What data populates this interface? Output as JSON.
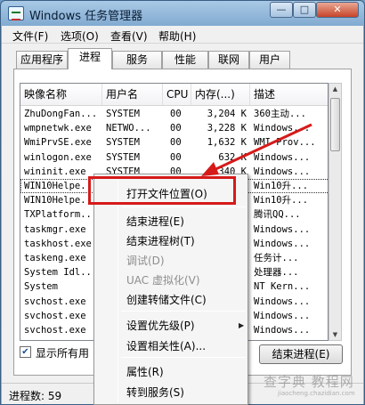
{
  "window": {
    "title": "Windows 任务管理器",
    "controls": {
      "minimize": "—",
      "maximize": "□",
      "close": "✕"
    }
  },
  "menu": [
    "文件(F)",
    "选项(O)",
    "查看(V)",
    "帮助(H)"
  ],
  "tabs": [
    {
      "label": "应用程序",
      "active": false
    },
    {
      "label": "进程",
      "active": true
    },
    {
      "label": "服务",
      "active": false
    },
    {
      "label": "性能",
      "active": false
    },
    {
      "label": "联网",
      "active": false
    },
    {
      "label": "用户",
      "active": false
    }
  ],
  "columns": [
    "映像名称",
    "用户名",
    "CPU",
    "内存(...)",
    "描述"
  ],
  "rows": [
    {
      "name": "ZhuDongFan...",
      "user": "SYSTEM",
      "cpu": "00",
      "mem": "3,204 K",
      "desc": "360主动..."
    },
    {
      "name": "wmpnetwk.exe",
      "user": "NETWO...",
      "cpu": "00",
      "mem": "3,228 K",
      "desc": "Windows..."
    },
    {
      "name": "WmiPrvSE.exe",
      "user": "SYSTEM",
      "cpu": "00",
      "mem": "1,632 K",
      "desc": "WMI Prov..."
    },
    {
      "name": "winlogon.exe",
      "user": "SYSTEM",
      "cpu": "00",
      "mem": "632 K",
      "desc": "Windows..."
    },
    {
      "name": "wininit.exe",
      "user": "SYSTEM",
      "cpu": "00",
      "mem": "340 K",
      "desc": "Windows..."
    },
    {
      "name": "WIN10Helpe...",
      "user": "",
      "cpu": "",
      "mem": "",
      "desc": "Win10升..."
    },
    {
      "name": "WIN10Helpe...",
      "user": "",
      "cpu": "",
      "mem": "",
      "desc": "Win10升..."
    },
    {
      "name": "TXPlatform...",
      "user": "",
      "cpu": "",
      "mem": "",
      "desc": "腾讯QQ..."
    },
    {
      "name": "taskmgr.exe",
      "user": "",
      "cpu": "",
      "mem": "",
      "desc": "Windows..."
    },
    {
      "name": "taskhost.exe",
      "user": "",
      "cpu": "",
      "mem": "",
      "desc": "Windows..."
    },
    {
      "name": "taskeng.exe",
      "user": "",
      "cpu": "",
      "mem": "",
      "desc": "任务计..."
    },
    {
      "name": "System Idl...",
      "user": "",
      "cpu": "",
      "mem": "",
      "desc": "处理器..."
    },
    {
      "name": "System",
      "user": "",
      "cpu": "",
      "mem": "",
      "desc": "NT Kern..."
    },
    {
      "name": "svchost.exe",
      "user": "",
      "cpu": "",
      "mem": "",
      "desc": "Windows..."
    },
    {
      "name": "svchost.exe",
      "user": "",
      "cpu": "",
      "mem": "",
      "desc": "Windows..."
    },
    {
      "name": "svchost.exe",
      "user": "",
      "cpu": "",
      "mem": "",
      "desc": "Windows..."
    }
  ],
  "show_all": {
    "label": "显示所有用",
    "checked": true
  },
  "end_process_button": "结束进程(E)",
  "status": "进程数: 59",
  "context_menu": {
    "items": [
      {
        "label": "打开文件位置(O)",
        "disabled": false,
        "submenu": false
      },
      {
        "label": "结束进程(E)",
        "disabled": false,
        "submenu": false
      },
      {
        "label": "结束进程树(T)",
        "disabled": false,
        "submenu": false
      },
      {
        "label": "调试(D)",
        "disabled": true,
        "submenu": false
      },
      {
        "label": "UAC 虚拟化(V)",
        "disabled": true,
        "submenu": false
      },
      {
        "label": "创建转储文件(C)",
        "disabled": false,
        "submenu": false
      },
      {
        "label": "设置优先级(P)",
        "disabled": false,
        "submenu": true
      },
      {
        "label": "设置相关性(A)...",
        "disabled": false,
        "submenu": false
      },
      {
        "label": "属性(R)",
        "disabled": false,
        "submenu": false
      },
      {
        "label": "转到服务(S)",
        "disabled": false,
        "submenu": false
      }
    ],
    "highlighted": "打开文件位置(O)"
  },
  "watermark": {
    "text": "查字典 教程网",
    "sub": "jiaocheng.chazidian.com"
  },
  "colors": {
    "highlight_box": "#d61a1a",
    "arrow": "#d61a1a"
  }
}
